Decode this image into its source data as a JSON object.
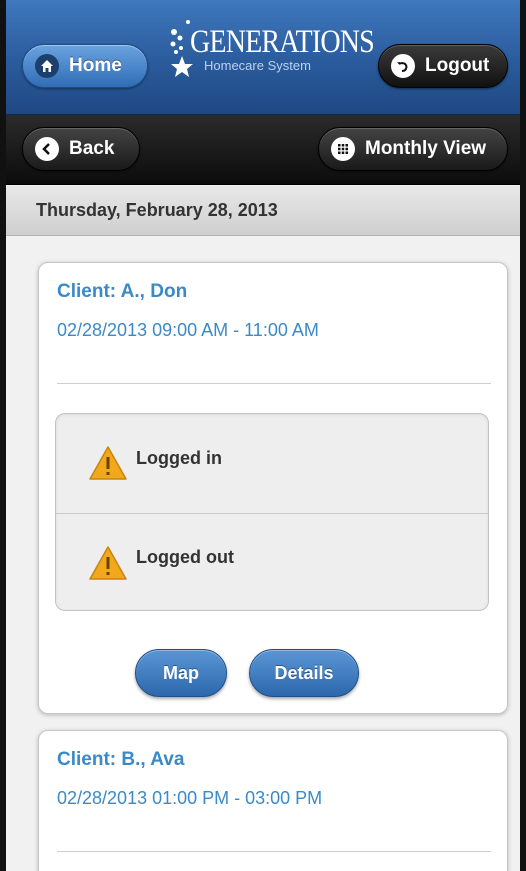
{
  "header": {
    "home_label": "Home",
    "logout_label": "Logout",
    "logo_title": "GENERATIONS",
    "logo_subtitle": "Homecare System"
  },
  "toolbar": {
    "back_label": "Back",
    "monthly_label": "Monthly View"
  },
  "date_header": "Thursday, February 28, 2013",
  "visits": [
    {
      "client": "Client: A., Don",
      "time": "02/28/2013 09:00 AM - 11:00 AM",
      "statuses": [
        {
          "label": "Logged in",
          "icon": "warning-icon"
        },
        {
          "label": "Logged out",
          "icon": "warning-icon"
        }
      ],
      "actions": {
        "map": "Map",
        "details": "Details"
      }
    },
    {
      "client": "Client: B., Ava",
      "time": "02/28/2013 01:00 PM - 03:00 PM"
    }
  ],
  "colors": {
    "header_blue": "#2a5b9c",
    "link_blue": "#3a8ac8",
    "warning_yellow": "#f2a81d",
    "toolbar_black": "#111111"
  }
}
